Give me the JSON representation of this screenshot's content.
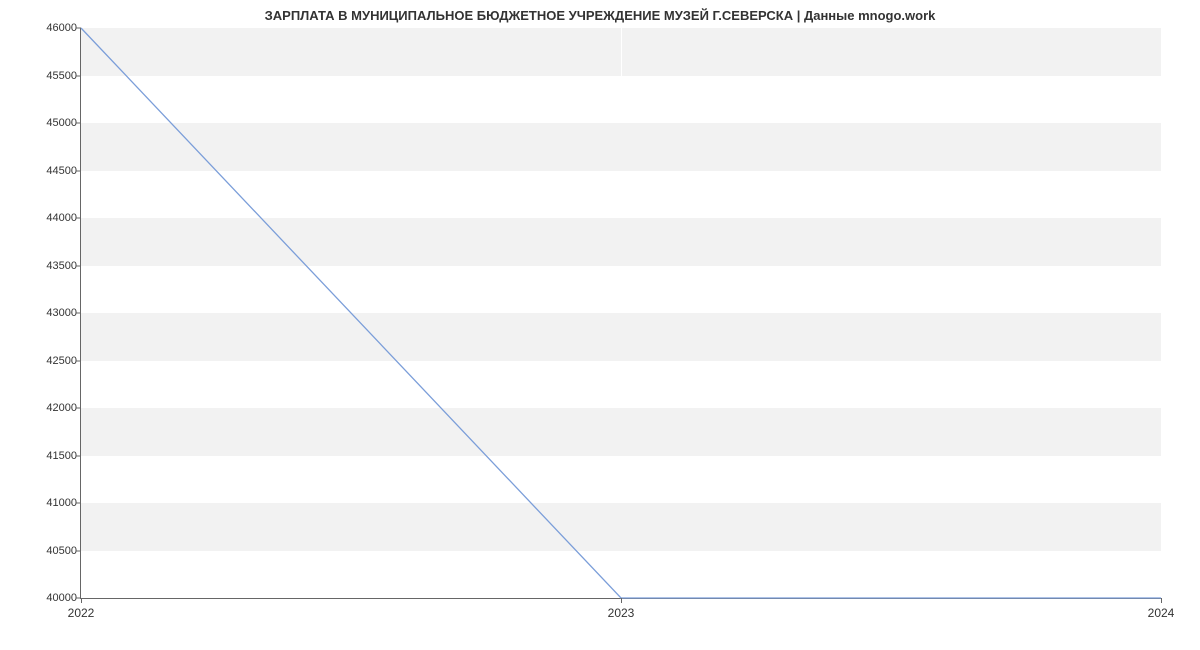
{
  "chart_data": {
    "type": "line",
    "title": "ЗАРПЛАТА В МУНИЦИПАЛЬНОЕ БЮДЖЕТНОЕ УЧРЕЖДЕНИЕ МУЗЕЙ Г.СЕВЕРСКА | Данные mnogo.work",
    "xlabel": "",
    "ylabel": "",
    "x_ticks": [
      "2022",
      "2023",
      "2024"
    ],
    "y_ticks": [
      40000,
      40500,
      41000,
      41500,
      42000,
      42500,
      43000,
      43500,
      44000,
      44500,
      45000,
      45500,
      46000
    ],
    "ylim": [
      40000,
      46000
    ],
    "xlim": [
      2022,
      2024
    ],
    "series": [
      {
        "name": "salary",
        "x": [
          2022,
          2023,
          2024
        ],
        "y": [
          46000,
          40000,
          40000
        ]
      }
    ]
  }
}
